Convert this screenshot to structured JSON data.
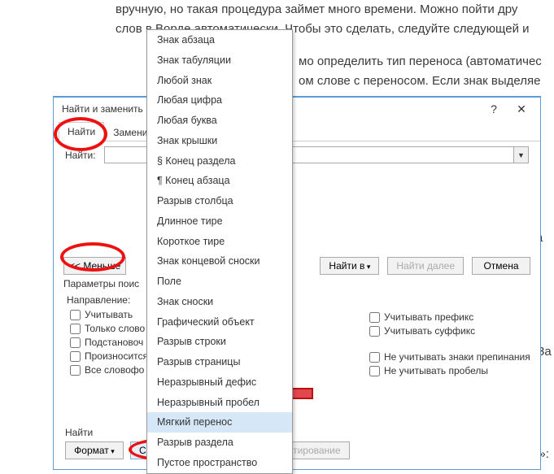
{
  "bg_paragraphs": [
    "вручную, но такая процедура займет много времени. Можно пойти дру",
    "слов в Ворде автоматически. Чтобы это сделать, следуйте следующей и",
    "мо определить тип переноса (автоматичес",
    "ом слове с переносом. Если знак выделяе",
    ""
  ],
  "side_text_1": "ка",
  "side_text_2": "»За",
  "side_text_3": "й»:",
  "dialog": {
    "title": "Найти и заменить",
    "help": "?",
    "close": "✕",
    "tabs": {
      "find": "Найти",
      "replace": "Замени"
    },
    "find_label": "Найти:",
    "btn_less": "<< Меньше",
    "btn_find_in": "Найти в",
    "btn_find_next": "Найти далее",
    "btn_cancel": "Отмена",
    "params_label": "Параметры поис",
    "direction_label": "Направление:",
    "chk_case": "Учитывать",
    "chk_whole": "Только слово",
    "chk_wildcard": "Подстановоч",
    "chk_sounds": "Произносится",
    "chk_allforms": "Все словофо",
    "chk_prefix": "Учитывать префикс",
    "chk_suffix": "Учитывать суффикс",
    "chk_punct": "Не учитывать знаки препинания",
    "chk_spaces": "Не учитывать пробелы",
    "bottom_label": "Найти",
    "btn_format": "Формат",
    "btn_special": "Специальный",
    "btn_clearfmt": "Снять форматирование"
  },
  "menu": [
    "Знак абзаца",
    "Знак табуляции",
    "Любой знак",
    "Любая цифра",
    "Любая буква",
    "Знак крышки",
    "§ Конец раздела",
    "¶ Конец абзаца",
    "Разрыв столбца",
    "Длинное тире",
    "Короткое тире",
    "Знак концевой сноски",
    "Поле",
    "Знак сноски",
    "Графический объект",
    "Разрыв строки",
    "Разрыв страницы",
    "Неразрывный дефис",
    "Неразрывный пробел",
    "Мягкий перенос",
    "Разрыв раздела",
    "Пустое пространство"
  ],
  "menu_selected_index": 19
}
